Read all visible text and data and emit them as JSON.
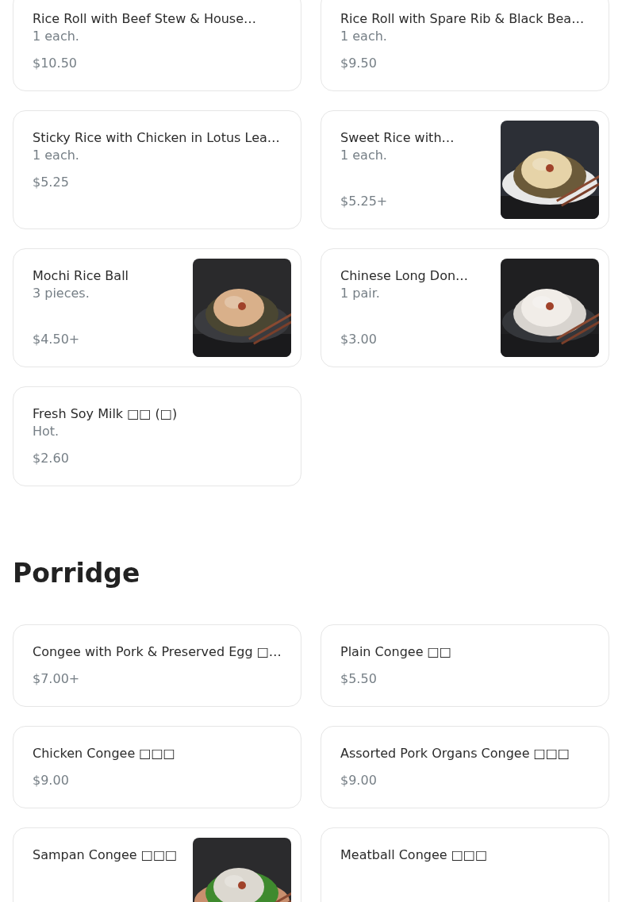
{
  "sections": [
    {
      "items": [
        {
          "name": "Rice Roll with Beef Stew & House…",
          "description": "1 each.",
          "price": "$10.50"
        },
        {
          "name": "Rice Roll with Spare Rib & Black Bea…",
          "description": "1 each.",
          "price": "$9.50"
        },
        {
          "name": "Sticky Rice with Chicken in Lotus Lea…",
          "description": "1 each.",
          "price": "$5.25"
        },
        {
          "name": "Sweet Rice with…",
          "description": "1 each.",
          "price": "$5.25+"
        },
        {
          "name": "Mochi Rice Ball",
          "description": "3 pieces.",
          "price": "$4.50+"
        },
        {
          "name": "Chinese Long Don…",
          "description": "1 pair.",
          "price": "$3.00"
        },
        {
          "name": "Fresh Soy Milk □□ (□)",
          "description": "Hot.",
          "price": "$2.60"
        }
      ]
    },
    {
      "title": "Porridge",
      "items": [
        {
          "name": "Congee with Pork & Preserved Egg □…",
          "price": "$7.00+"
        },
        {
          "name": "Plain Congee □□",
          "price": "$5.50"
        },
        {
          "name": "Chicken Congee □□□",
          "price": "$9.00"
        },
        {
          "name": "Assorted Pork Organs Congee □□□",
          "price": "$9.00"
        },
        {
          "name": "Sampan Congee □□□"
        },
        {
          "name": "Meatball Congee □□□"
        }
      ]
    }
  ]
}
